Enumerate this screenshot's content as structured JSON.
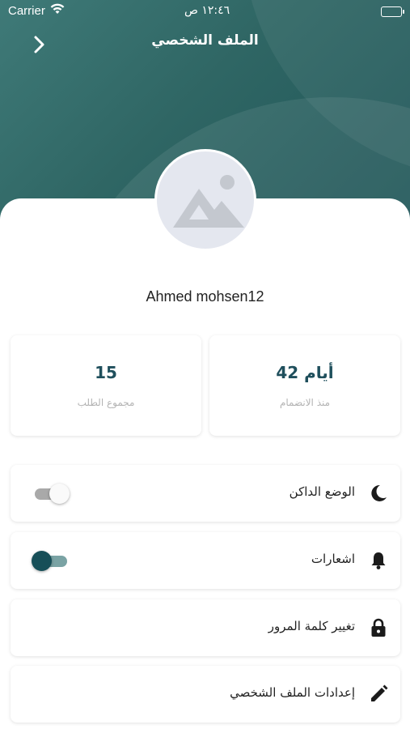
{
  "status_bar": {
    "carrier": "Carrier",
    "time": "١٢:٤٦ ص"
  },
  "header": {
    "title": "الملف الشخصي"
  },
  "profile": {
    "name": "Ahmed mohsen12"
  },
  "stats": [
    {
      "value": "15",
      "label": "مجموع الطلب"
    },
    {
      "value": "42 أيام",
      "label": "منذ الانضمام"
    }
  ],
  "menu": {
    "dark_mode": {
      "label": "الوضع الداكن",
      "icon": "moon-icon",
      "toggle": false
    },
    "notifications": {
      "label": "اشعارات",
      "icon": "bell-icon",
      "toggle": true
    },
    "change_password": {
      "label": "تغيير كلمة المرور",
      "icon": "lock-icon"
    },
    "profile_settings": {
      "label": "إعدادات الملف الشخصي",
      "icon": "pencil-icon"
    }
  },
  "colors": {
    "primary": "#1f5558",
    "accent_text": "#1f4f5c"
  }
}
